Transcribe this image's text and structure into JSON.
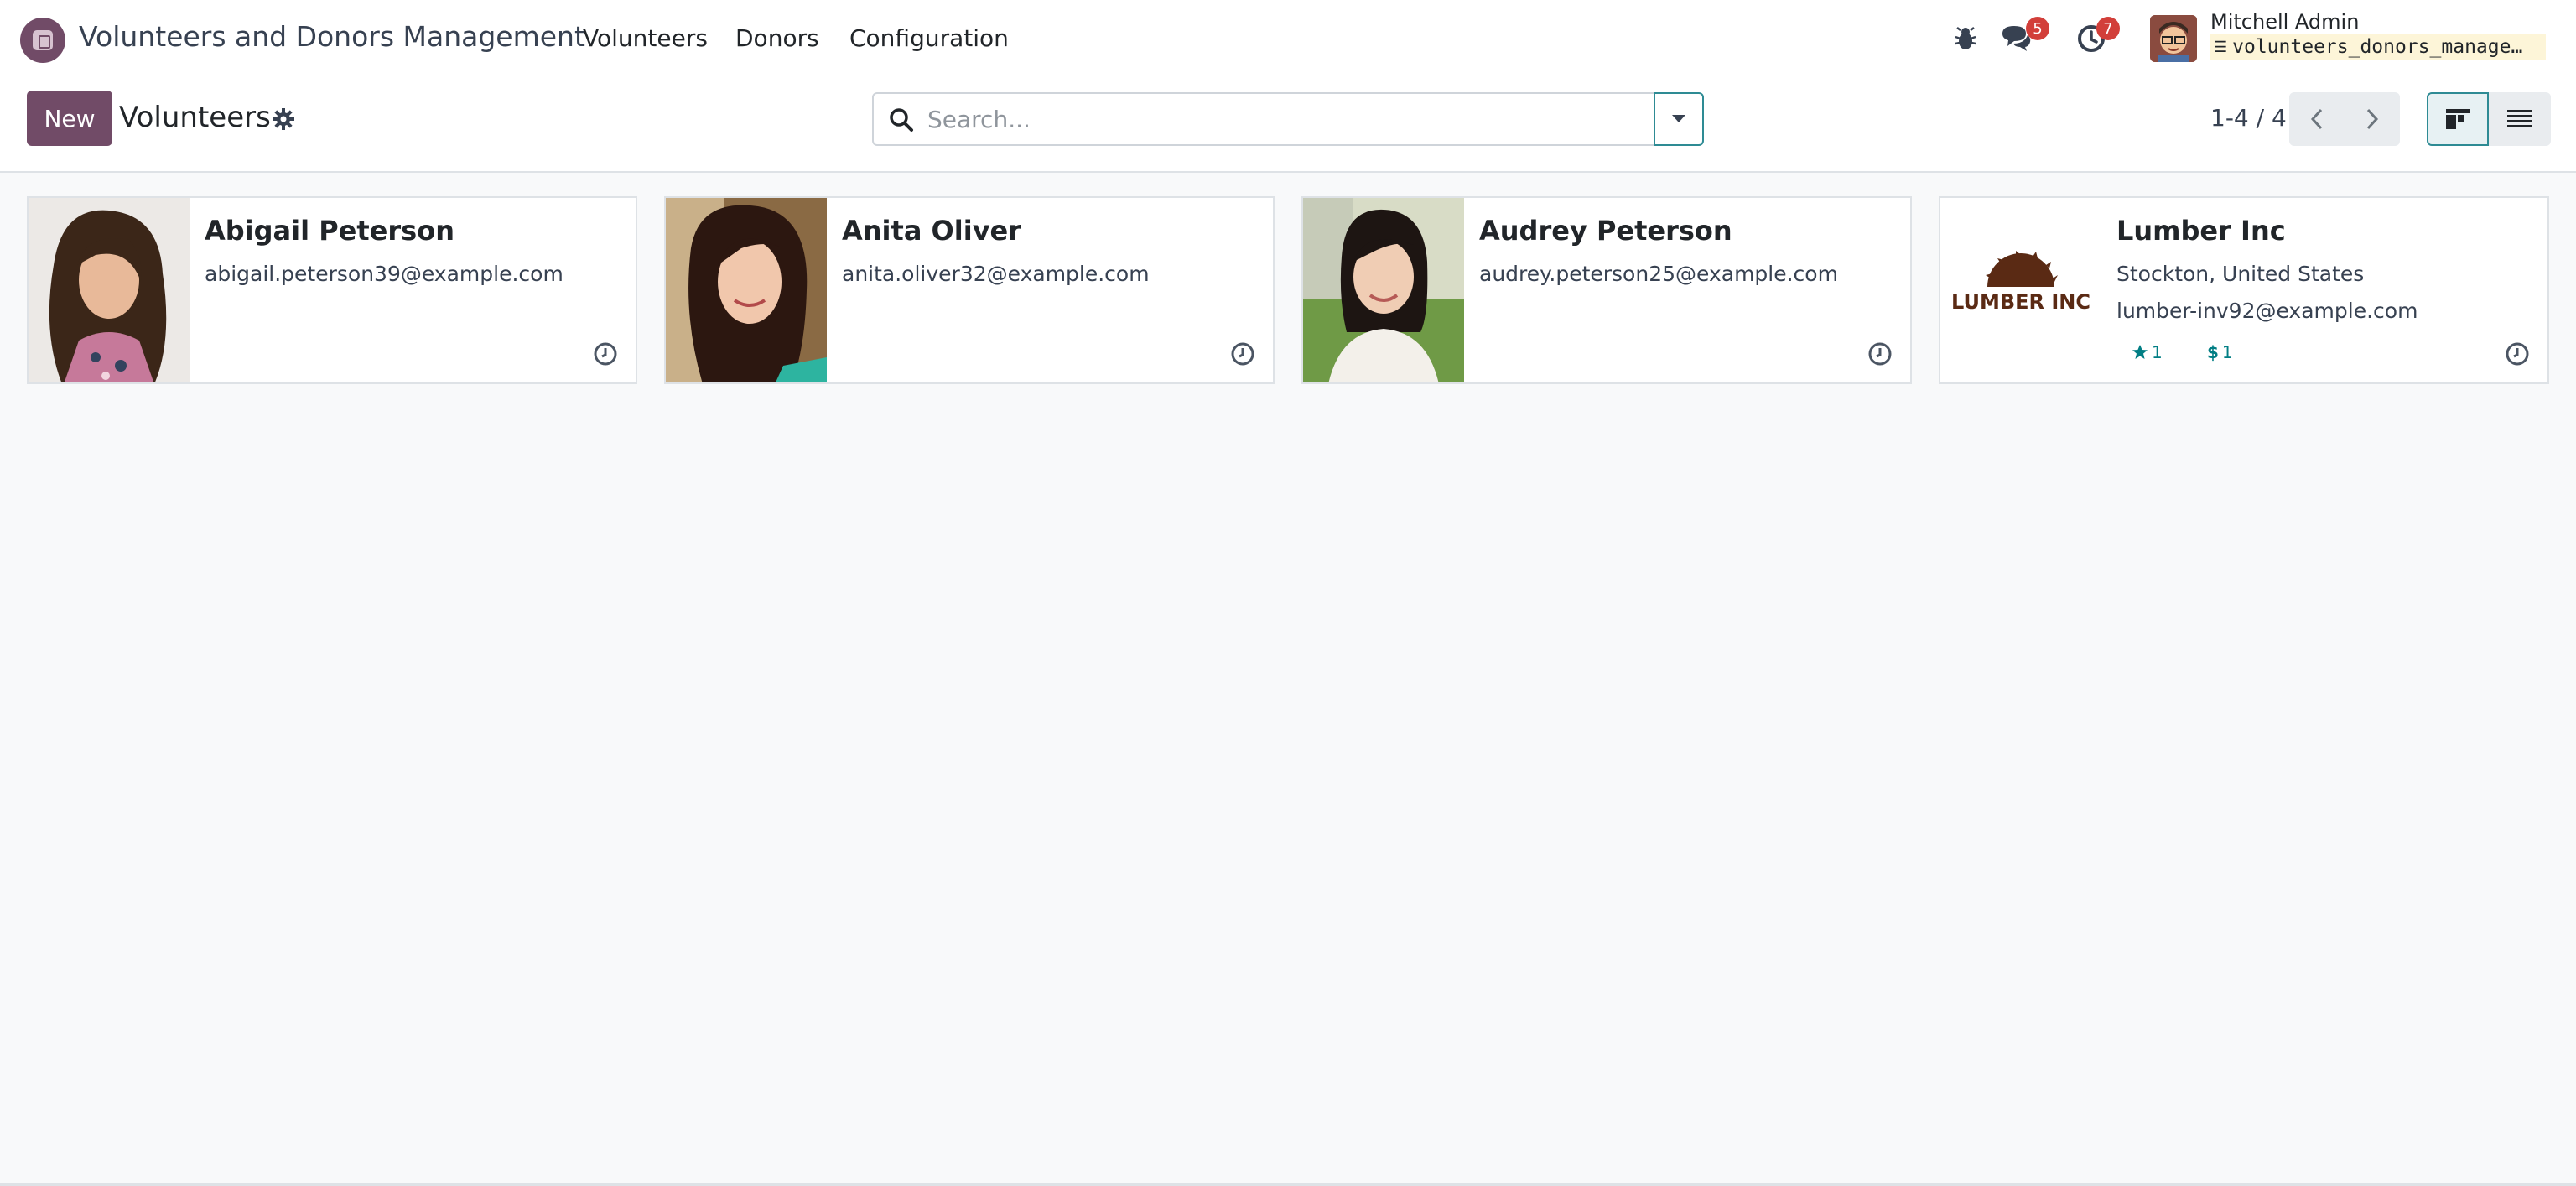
{
  "navbar": {
    "app_title": "Volunteers and Donors Management",
    "menu": [
      {
        "label": "Volunteers"
      },
      {
        "label": "Donors"
      },
      {
        "label": "Configuration"
      }
    ],
    "messages_badge": "5",
    "activities_badge": "7",
    "user_name": "Mitchell Admin",
    "database": "volunteers_donors_manage…"
  },
  "control": {
    "new_label": "New",
    "title": "Volunteers",
    "search_placeholder": "Search...",
    "pager": "1-4 / 4"
  },
  "cards": [
    {
      "name": "Abigail Peterson",
      "line1": "abigail.peterson39@example.com",
      "line2": ""
    },
    {
      "name": "Anita Oliver",
      "line1": "anita.oliver32@example.com",
      "line2": ""
    },
    {
      "name": "Audrey Peterson",
      "line1": "audrey.peterson25@example.com",
      "line2": ""
    },
    {
      "name": "Lumber Inc",
      "line1": "Stockton, United States",
      "line2": "lumber-inv92@example.com",
      "logo_text": "LUMBER INC",
      "stat_star": "1",
      "stat_dollar": "1"
    }
  ],
  "colors": {
    "brand": "#714b67",
    "accent": "#017e84",
    "badge": "#d23f3a"
  }
}
